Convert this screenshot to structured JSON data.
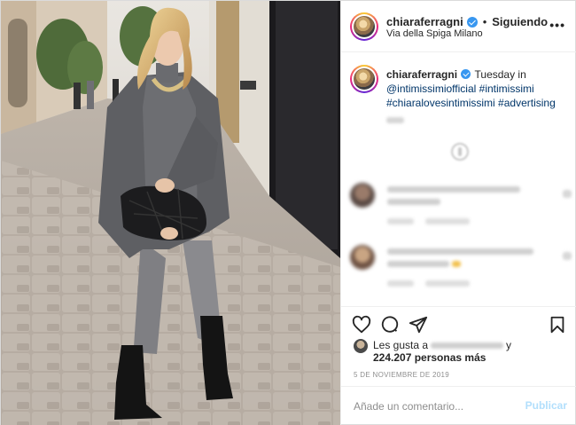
{
  "post": {
    "username": "chiaraferragni",
    "following_label": "Siguiendo",
    "location": "Via della Spiga Milano",
    "more_icon": "more-dots-icon"
  },
  "caption": {
    "username": "chiaraferragni",
    "text_lead": "Tuesday in",
    "tag_1": "@intimissimiofficial",
    "tag_2": "#intimissimi",
    "tag_3": "#chiaralovesintimissimi",
    "tag_4": "#advertising"
  },
  "actions": {
    "icons": [
      "heart-icon",
      "comment-icon",
      "share-icon",
      "bookmark-icon"
    ]
  },
  "likes": {
    "prefix": "Les gusta a",
    "suffix": "y",
    "count_text": "224.207 personas más"
  },
  "post_date": "5 DE NOVIEMBRE DE 2019",
  "comment_box": {
    "placeholder": "Añade un comentario...",
    "publish_label": "Publicar"
  },
  "colors": {
    "verified": "#3897f0",
    "hashtag": "#003569",
    "publish_disabled": "#b2dffc",
    "secondary_text": "#8e8e8e"
  }
}
